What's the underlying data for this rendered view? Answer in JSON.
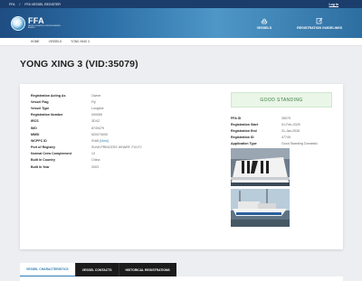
{
  "topbar": {
    "crumb_home": "FFA",
    "crumb_sep": "/",
    "crumb_current": "FFA VESSEL REGISTER",
    "login": "Log In"
  },
  "banner": {
    "logo_big": "FFA",
    "logo_small": "PACIFIC ISLANDS FORUM FISHERIES AGENCY",
    "nav": [
      {
        "label": "VESSELS",
        "icon": "ship-icon"
      },
      {
        "label": "REGISTRATION GUIDELINES",
        "icon": "edit-icon"
      }
    ]
  },
  "breadcrumb": [
    "HOME",
    "VESSELS",
    "YONG XING 3"
  ],
  "page_title": "YONG XING 3 (VID:35079)",
  "details": [
    {
      "label": "Registration Acting As",
      "value": "Owner"
    },
    {
      "label": "Vessel Flag",
      "value": "Fiji"
    },
    {
      "label": "Vessel Type",
      "value": "Longline"
    },
    {
      "label": "Registration Number",
      "value": "000065"
    },
    {
      "label": "IRCS",
      "value": "3DXZ"
    },
    {
      "label": "IMO",
      "value": "8749479"
    },
    {
      "label": "MMSI",
      "value": "520074000"
    },
    {
      "label": "WCPFC ID",
      "value": "9168",
      "link": "[View]"
    },
    {
      "label": "Port of Registry",
      "value": "SUVA PRINCESS WHARF, FIJI,FJ"
    },
    {
      "label": "Normal Crew Complement",
      "value": "13"
    },
    {
      "label": "Built In Country",
      "value": "China"
    },
    {
      "label": "Built In Year",
      "value": "2003"
    }
  ],
  "status": {
    "standing": "GOOD STANDING",
    "color": "#3b7a3b",
    "rows": [
      {
        "label": "FFA ID",
        "value": "35079"
      },
      {
        "label": "Registration Start",
        "value": "01-Feb-2025"
      },
      {
        "label": "Registration End",
        "value": "31-Jan-2026"
      },
      {
        "label": "Registration ID",
        "value": "47749"
      },
      {
        "label": "Application Type",
        "value": "Good Standing Domestic"
      }
    ]
  },
  "tabs": [
    {
      "label": "VESSEL CHARACTERISTICS",
      "active": true
    },
    {
      "label": "VESSEL CONTACTS",
      "active": false
    },
    {
      "label": "HISTORICAL REGISTRATIONS",
      "active": false
    }
  ],
  "colors": {
    "brand": "#1b3d6b",
    "accent": "#2c7bb0"
  }
}
